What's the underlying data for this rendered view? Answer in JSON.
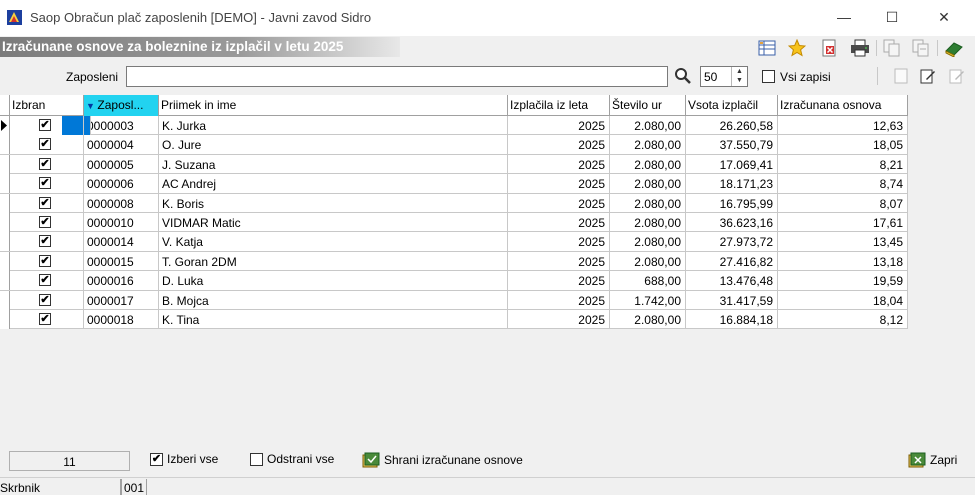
{
  "window": {
    "title": "Saop Obračun plač zaposlenih [DEMO] - Javni zavod Sidro",
    "minimize": "—",
    "maximize": "☐",
    "close": "✕"
  },
  "header": {
    "title": "Izračunane osnove za boleznine iz izplačil v letu 2025"
  },
  "toolbar": {
    "icons": [
      "table-icon",
      "star-icon",
      "delete-icon",
      "printer-icon",
      "copy-icon",
      "copy-alt-icon",
      "book-exit-icon"
    ]
  },
  "filter": {
    "label": "Zaposleni",
    "value": "",
    "limit": "50",
    "all_records_label": "Vsi zapisi"
  },
  "grid": {
    "columns": [
      "Izbran",
      "Zaposl...",
      "Priimek in ime",
      "Izplačila iz leta",
      "Število ur",
      "Vsota izplačil",
      "Izračunana osnova"
    ],
    "rows": [
      {
        "checked": "✔",
        "id": "0000003",
        "name": "K. Jurka",
        "year": "2025",
        "hours": "2.080,00",
        "sum": "26.260,58",
        "base": "12,63"
      },
      {
        "checked": "✔",
        "id": "0000004",
        "name": "O. Jure",
        "year": "2025",
        "hours": "2.080,00",
        "sum": "37.550,79",
        "base": "18,05"
      },
      {
        "checked": "✔",
        "id": "0000005",
        "name": "J. Suzana",
        "year": "2025",
        "hours": "2.080,00",
        "sum": "17.069,41",
        "base": "8,21"
      },
      {
        "checked": "✔",
        "id": "0000006",
        "name": "AC Andrej",
        "year": "2025",
        "hours": "2.080,00",
        "sum": "18.171,23",
        "base": "8,74"
      },
      {
        "checked": "✔",
        "id": "0000008",
        "name": "K. Boris",
        "year": "2025",
        "hours": "2.080,00",
        "sum": "16.795,99",
        "base": "8,07"
      },
      {
        "checked": "✔",
        "id": "0000010",
        "name": "VIDMAR Matic",
        "year": "2025",
        "hours": "2.080,00",
        "sum": "36.623,16",
        "base": "17,61"
      },
      {
        "checked": "✔",
        "id": "0000014",
        "name": "V. Katja",
        "year": "2025",
        "hours": "2.080,00",
        "sum": "27.973,72",
        "base": "13,45"
      },
      {
        "checked": "✔",
        "id": "0000015",
        "name": "T. Goran 2DM",
        "year": "2025",
        "hours": "2.080,00",
        "sum": "27.416,82",
        "base": "13,18"
      },
      {
        "checked": "✔",
        "id": "0000016",
        "name": "D. Luka",
        "year": "2025",
        "hours": "688,00",
        "sum": "13.476,48",
        "base": "19,59"
      },
      {
        "checked": "✔",
        "id": "0000017",
        "name": "B.  Mojca",
        "year": "2025",
        "hours": "1.742,00",
        "sum": "31.417,59",
        "base": "18,04"
      },
      {
        "checked": "✔",
        "id": "0000018",
        "name": "K. Tina",
        "year": "2025",
        "hours": "2.080,00",
        "sum": "16.884,18",
        "base": "8,12"
      }
    ]
  },
  "footer": {
    "count": "11",
    "select_all": "Izberi vse",
    "select_all_checked": "✔",
    "remove_all": "Odstrani vse",
    "save_label": "Shrani izračunane osnove",
    "close_label": "Zapri"
  },
  "status": {
    "user": "Skrbnik",
    "code": "001"
  },
  "colors": {
    "selection": "#0078d7",
    "sorted_header": "#22d3f0"
  }
}
